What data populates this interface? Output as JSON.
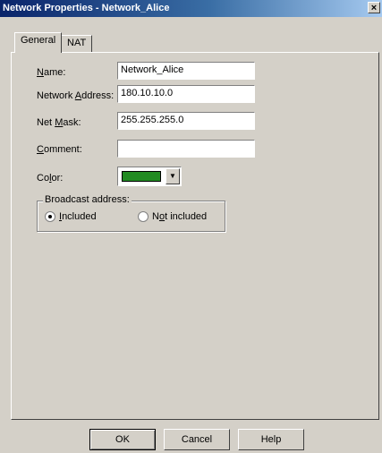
{
  "window": {
    "title": "Network Properties - Network_Alice",
    "close_glyph": "×"
  },
  "tabs": [
    {
      "label": "General",
      "active": true
    },
    {
      "label": "NAT",
      "active": false
    }
  ],
  "form": {
    "name": {
      "label_mnemonic": "N",
      "label_rest": "ame:",
      "value": "Network_Alice"
    },
    "network_address": {
      "label_pre": "Network ",
      "label_mnemonic": "A",
      "label_rest": "ddress:",
      "value": "180.10.10.0"
    },
    "net_mask": {
      "label_pre": "Net ",
      "label_mnemonic": "M",
      "label_rest": "ask:",
      "value": "255.255.255.0"
    },
    "comment": {
      "label_mnemonic": "C",
      "label_rest": "omment:",
      "value": ""
    },
    "color": {
      "label_pre": "Co",
      "label_mnemonic": "l",
      "label_rest": "or:",
      "value": "#228b22",
      "dropdown_glyph": "▼"
    }
  },
  "broadcast": {
    "legend": "Broadcast address:",
    "included": {
      "label_mnemonic": "I",
      "label_rest": "ncluded",
      "selected": true
    },
    "not_included": {
      "label_pre": "N",
      "label_mnemonic": "o",
      "label_rest": "t included",
      "selected": false
    }
  },
  "buttons": {
    "ok": "OK",
    "cancel": "Cancel",
    "help": "Help"
  }
}
